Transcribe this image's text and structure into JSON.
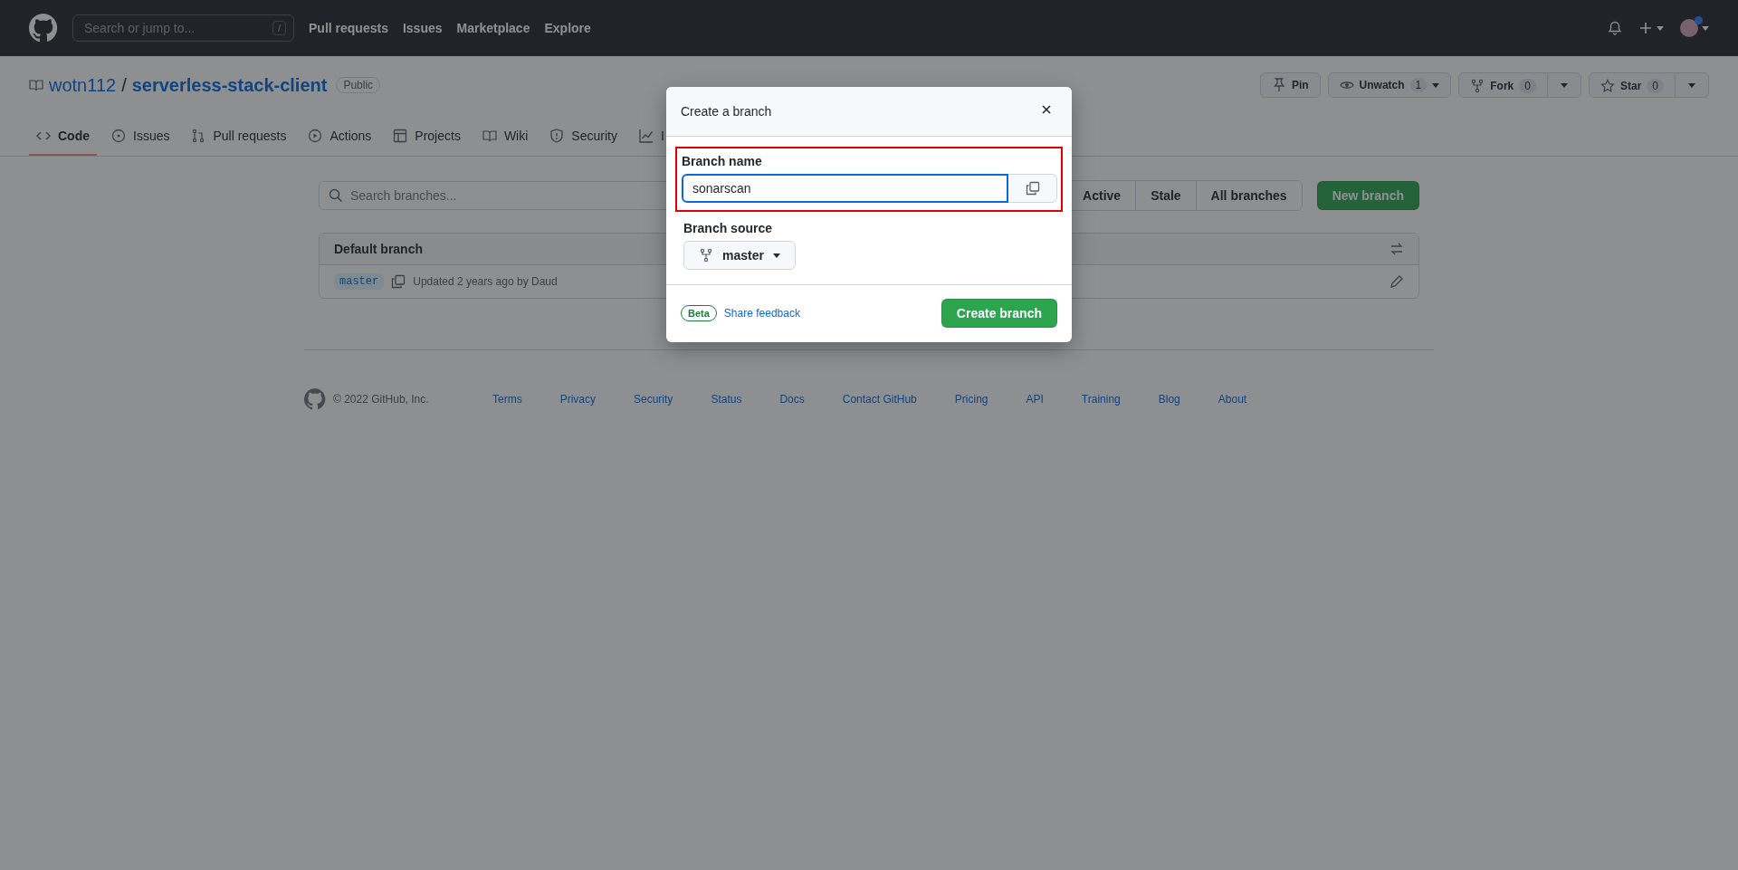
{
  "header": {
    "search_placeholder": "Search or jump to...",
    "search_key": "/",
    "nav": [
      "Pull requests",
      "Issues",
      "Marketplace",
      "Explore"
    ]
  },
  "repo": {
    "owner": "wotn112",
    "separator": "/",
    "name": "serverless-stack-client",
    "visibility": "Public",
    "actions": [
      {
        "kind": "simple",
        "label": "Pin"
      },
      {
        "kind": "inline-caret",
        "label": "Unwatch",
        "count": "1"
      },
      {
        "kind": "split",
        "label": "Fork",
        "count": "0"
      },
      {
        "kind": "split",
        "label": "Star",
        "count": "0"
      }
    ]
  },
  "tabs": [
    {
      "label": "Code",
      "selected": true
    },
    {
      "label": "Issues",
      "selected": false
    },
    {
      "label": "Pull requests",
      "selected": false
    },
    {
      "label": "Actions",
      "selected": false
    },
    {
      "label": "Projects",
      "selected": false
    },
    {
      "label": "Wiki",
      "selected": false
    },
    {
      "label": "Security",
      "selected": false
    },
    {
      "label": "I",
      "selected": false
    }
  ],
  "branches": {
    "search_placeholder": "Search branches...",
    "filters": [
      "Active",
      "Stale",
      "All branches"
    ],
    "new_button": "New branch",
    "default_section": {
      "title": "Default branch",
      "rows": [
        {
          "branch": "master",
          "updated": "Updated 2 years ago by Daud"
        }
      ]
    }
  },
  "footer": {
    "copyright": "© 2022 GitHub, Inc.",
    "links": [
      "Terms",
      "Privacy",
      "Security",
      "Status",
      "Docs",
      "Contact GitHub",
      "Pricing",
      "API",
      "Training",
      "Blog",
      "About"
    ]
  },
  "modal": {
    "title": "Create a branch",
    "name_label": "Branch name",
    "name_value": "sonarscan",
    "name_highlighted": true,
    "source_label": "Branch source",
    "source_value": "master",
    "badge": "Beta",
    "feedback": "Share feedback",
    "submit": "Create branch"
  }
}
